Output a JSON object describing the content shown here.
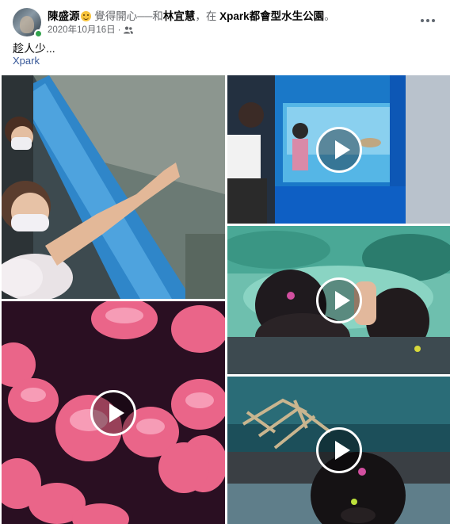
{
  "post": {
    "author": "陳盛源",
    "feeling_text": " 覺得開心──和",
    "tagged_user": "林宜慧",
    "at_text": "，在 ",
    "location": "Xpark都會型水生公園",
    "end_punct": "。",
    "date": "2020年10月16日",
    "date_sep": "·",
    "audience_icon": "friends-icon",
    "caption": "趁人少...",
    "checkin_link": "Xpark"
  },
  "colors": {
    "link": "#385898",
    "online": "#31a24c",
    "muted": "#65676b"
  },
  "media": [
    {
      "type": "video",
      "subject": "child at aquarium tunnel",
      "has_play_button": false
    },
    {
      "type": "video",
      "subject": "crowd at blue tank",
      "has_play_button": true
    },
    {
      "type": "video",
      "subject": "children at glass floor",
      "has_play_button": true
    },
    {
      "type": "video",
      "subject": "pink jellyfish",
      "has_play_button": true
    },
    {
      "type": "video",
      "subject": "coral and child",
      "has_play_button": true
    }
  ]
}
